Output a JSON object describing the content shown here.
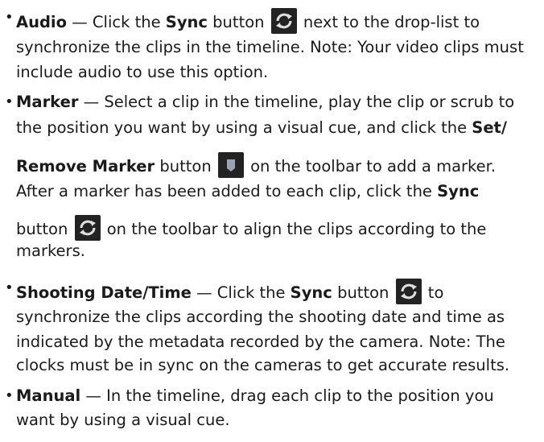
{
  "items": [
    {
      "term": "Audio",
      "line1_pre": " — Click the ",
      "line1_kw": "Sync",
      "line1_mid": " button",
      "line1_post": " next to the drop-list to",
      "line2": "synchronize the clips in the timeline. Note: Your video clips must",
      "line3": "include audio to use this option."
    },
    {
      "term": "Marker",
      "line1": " — Select a clip in the timeline, play the clip or scrub to",
      "line2_pre": "the position you want by using a visual cue, and click the ",
      "line2_kw": "Set/",
      "line3_kw": "Remove Marker",
      "line3_mid": " button",
      "line3_post": " on the toolbar to add a marker.",
      "line4_pre": "After a marker has been added to each clip, click the ",
      "line4_kw": "Sync",
      "line5_pre": "button",
      "line5_post": " on the toolbar to align the clips according to the",
      "line6": "markers."
    },
    {
      "term": "Shooting Date/Time",
      "line1_pre": " — Click the ",
      "line1_kw": "Sync",
      "line1_mid": " button",
      "line1_post": " to",
      "line2": "synchronize the clips according the shooting date and time as",
      "line3": "indicated by the metadata recorded by the camera. Note: The",
      "line4": "clocks must be in sync on the cameras to get accurate results."
    },
    {
      "term": "Manual",
      "line1": " — In the timeline, drag each clip to the position you",
      "line2": "want by using a visual cue."
    }
  ],
  "icons": {
    "sync": "sync-icon",
    "marker": "marker-icon"
  },
  "colors": {
    "text": "#1a1a1a",
    "icon_bg": "#232323",
    "sync_arc": "#e0e0e0",
    "marker_fill": "#9aa3b3"
  }
}
